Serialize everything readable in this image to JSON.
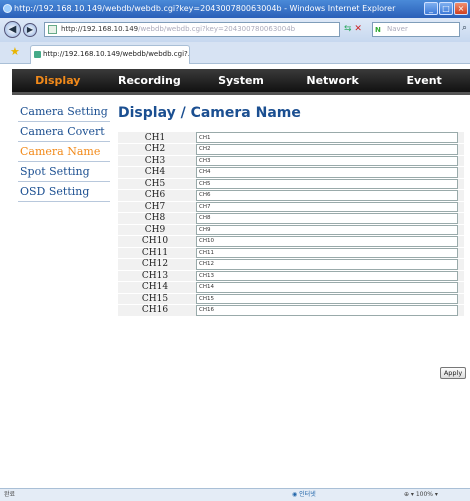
{
  "browser": {
    "title": "http://192.168.10.149/webdb/webdb.cgi?key=204300780063004b - Windows Internet Explorer",
    "address_host": "http://192.168.10.149",
    "address_path": "/webdb/webdb.cgi?key=204300780063004b",
    "search_placeholder": "Naver",
    "tab_title": "http://192.168.10.149/webdb/webdb.cgi?...",
    "status_done": "완료",
    "status_zone": "인터넷",
    "status_zoom": "100%"
  },
  "menubar": {
    "items": [
      {
        "label": "Display",
        "active": true
      },
      {
        "label": "Recording",
        "active": false
      },
      {
        "label": "System",
        "active": false
      },
      {
        "label": "Network",
        "active": false
      },
      {
        "label": "Event",
        "active": false
      }
    ]
  },
  "sidebar": {
    "items": [
      {
        "label": "Camera Setting",
        "active": false
      },
      {
        "label": "Camera Covert",
        "active": false
      },
      {
        "label": "Camera Name",
        "active": true
      },
      {
        "label": "Spot Setting",
        "active": false
      },
      {
        "label": "OSD Setting",
        "active": false
      }
    ]
  },
  "page": {
    "title": "Display / Camera Name",
    "apply_label": "Apply"
  },
  "channels": [
    {
      "label": "CH1",
      "value": "CH1"
    },
    {
      "label": "CH2",
      "value": "CH2"
    },
    {
      "label": "CH3",
      "value": "CH3"
    },
    {
      "label": "CH4",
      "value": "CH4"
    },
    {
      "label": "CH5",
      "value": "CH5"
    },
    {
      "label": "CH6",
      "value": "CH6"
    },
    {
      "label": "CH7",
      "value": "CH7"
    },
    {
      "label": "CH8",
      "value": "CH8"
    },
    {
      "label": "CH9",
      "value": "CH9"
    },
    {
      "label": "CH10",
      "value": "CH10"
    },
    {
      "label": "CH11",
      "value": "CH11"
    },
    {
      "label": "CH12",
      "value": "CH12"
    },
    {
      "label": "CH13",
      "value": "CH13"
    },
    {
      "label": "CH14",
      "value": "CH14"
    },
    {
      "label": "CH15",
      "value": "CH15"
    },
    {
      "label": "CH16",
      "value": "CH16"
    }
  ],
  "colors": {
    "accent": "#f28a1a",
    "link": "#1b4f91",
    "menubar": "#111111"
  }
}
